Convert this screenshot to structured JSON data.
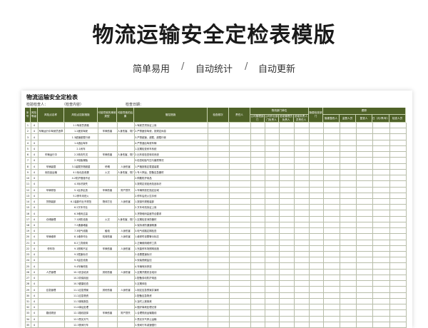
{
  "banner": {
    "title": "物流运输安全定检表模版",
    "features": [
      "简单易用",
      "自动统计",
      "自动更新"
    ],
    "separator": "/"
  },
  "sheet": {
    "title": "物流运输安全定检表",
    "meta": [
      "检验检查人：",
      "（检查内容）",
      "检查日期："
    ],
    "headers": {
      "seq": "序号",
      "risk_level": "风险等级",
      "risk_point": "风险点名称",
      "hazard": "风险点控制措施",
      "accident_type": "可能导致的事故类型",
      "consequence": "可能导致的后果",
      "control": "管控措施",
      "frequency": "检查频次",
      "responsible": "责任人",
      "group_main": "物流部门单位",
      "group_check": "跟踪",
      "sub": [
        "公司管理部门",
        "公司作业部门负责人",
        "班组管理员负责人",
        "班组负责人员责任人",
        "隐患检查部门",
        "隐患整改人",
        "监督人员",
        "复查人",
        "日（月/季/年）",
        "检查人员"
      ]
    },
    "rows": [
      {
        "seq": "1",
        "lvl": "4",
        "point": "",
        "item": "1.1驾驶员资格",
        "type": "",
        "result": "",
        "measure": "1.驾驶员须持证上岗"
      },
      {
        "seq": "2",
        "lvl": "4",
        "point": "车辆运行中驾驶员违章",
        "item": "1.2疲劳驾驶",
        "type": "车辆伤害",
        "result": "人身伤害、财产损失",
        "measure": "2.严禁疲劳驾驶，按规定休息"
      },
      {
        "seq": "3",
        "lvl": "4",
        "point": "",
        "item": "1.3超速超载行驶",
        "type": "",
        "result": "",
        "measure": "3.严禁超速、超载、超限行驶"
      },
      {
        "seq": "4",
        "lvl": "4",
        "point": "",
        "item": "1.4酒后驾车",
        "type": "",
        "result": "",
        "measure": "4.严禁酒后驾驶车辆"
      },
      {
        "seq": "5",
        "lvl": "4",
        "point": "",
        "item": "2.1刹车",
        "type": "",
        "result": "",
        "measure": "1.定期检查刹车系统"
      },
      {
        "seq": "6",
        "lvl": "4",
        "point": "车辆运行中",
        "item": "2.2转向失灵",
        "type": "车辆伤害",
        "result": "人身伤害、财产损失",
        "measure": "2.出车前检查转向系统"
      },
      {
        "seq": "7",
        "lvl": "4",
        "point": "",
        "item": "2.3轮胎爆胎",
        "type": "",
        "result": "",
        "measure": "3.检查轮胎气压与磨损情况"
      },
      {
        "seq": "8",
        "lvl": "4",
        "point": "车辆装载",
        "item": "3.1装载货物超重",
        "type": "坍塌",
        "result": "人身伤害",
        "measure": "1.严格按核定载重装载"
      },
      {
        "seq": "9",
        "lvl": "4",
        "point": "危险品运输",
        "item": "4.1危化品泄漏",
        "type": "火灾",
        "result": "人身伤害、财产损失",
        "measure": "1.专人押运，配备应急器材"
      },
      {
        "seq": "10",
        "lvl": "4",
        "point": "",
        "item": "4.2防护措施不足",
        "type": "",
        "result": "",
        "measure": "2.佩戴防护用品"
      },
      {
        "seq": "11",
        "lvl": "4",
        "point": "",
        "item": "4.3标识缺失",
        "type": "",
        "result": "",
        "measure": "3.按规定张贴危险品标识"
      },
      {
        "seq": "12",
        "lvl": "4",
        "point": "车辆停放",
        "item": "5.1乱停乱放",
        "type": "车辆伤害",
        "result": "财产损失",
        "measure": "1.车辆停放在指定区域"
      },
      {
        "seq": "13",
        "lvl": "4",
        "point": "",
        "item": "5.2停车未熄火",
        "type": "",
        "result": "",
        "measure": "2.停车后熄火拉手刹"
      },
      {
        "seq": "14",
        "lvl": "4",
        "point": "货物装卸",
        "item": "6.1装卸作业不规范",
        "type": "物体打击",
        "result": "人身伤害",
        "measure": "1.按操作规程装卸"
      },
      {
        "seq": "15",
        "lvl": "4",
        "point": "",
        "item": "6.2叉车作业",
        "type": "",
        "result": "",
        "measure": "2.叉车司机持证上岗"
      },
      {
        "seq": "16",
        "lvl": "4",
        "point": "",
        "item": "6.3堆码过高",
        "type": "",
        "result": "",
        "measure": "3.货物堆码高度符合要求"
      },
      {
        "seq": "17",
        "lvl": "4",
        "point": "仓储管理",
        "item": "7.1消防设施",
        "type": "火灾",
        "result": "人身伤害、财产损失",
        "measure": "1.定期检查消防器材"
      },
      {
        "seq": "18",
        "lvl": "4",
        "point": "",
        "item": "7.2通道堵塞",
        "type": "",
        "result": "",
        "measure": "2.保持消防通道畅通"
      },
      {
        "seq": "19",
        "lvl": "4",
        "point": "",
        "item": "7.3电气线路",
        "type": "触电",
        "result": "人身伤害",
        "measure": "3.电气线路定期检查"
      },
      {
        "seq": "20",
        "lvl": "4",
        "point": "车辆维修",
        "item": "8.1维修作业",
        "type": "机械伤害",
        "result": "人身伤害",
        "measure": "1.维修时设置警示标志"
      },
      {
        "seq": "21",
        "lvl": "4",
        "point": "",
        "item": "8.2工具使用",
        "type": "",
        "result": "",
        "measure": "2.正确使用维修工具"
      },
      {
        "seq": "22",
        "lvl": "4",
        "point": "停车场",
        "item": "9.1照明不足",
        "type": "车辆伤害",
        "result": "人身伤害",
        "measure": "1.完善停车场照明设施"
      },
      {
        "seq": "23",
        "lvl": "4",
        "point": "",
        "item": "9.2限速标识",
        "type": "",
        "result": "",
        "measure": "2.设置限速标识"
      },
      {
        "seq": "24",
        "lvl": "4",
        "point": "",
        "item": "9.3监控设施",
        "type": "",
        "result": "",
        "measure": "3.安装视频监控"
      },
      {
        "seq": "25",
        "lvl": "4",
        "point": "",
        "item": "9.4车辆停放",
        "type": "",
        "result": "",
        "measure": "4.车辆有序停放"
      },
      {
        "seq": "26",
        "lvl": "4",
        "point": "人员管理",
        "item": "10.1安全培训",
        "type": "其他伤害",
        "result": "人身伤害",
        "measure": "1.定期开展安全培训"
      },
      {
        "seq": "27",
        "lvl": "4",
        "point": "",
        "item": "10.2劳保用品",
        "type": "",
        "result": "",
        "measure": "2.配备劳动防护用品"
      },
      {
        "seq": "28",
        "lvl": "4",
        "point": "",
        "item": "10.3健康检查",
        "type": "",
        "result": "",
        "measure": "3.定期体检"
      },
      {
        "seq": "29",
        "lvl": "4",
        "point": "应急管理",
        "item": "11.1应急预案",
        "type": "其他伤害",
        "result": "人身伤害",
        "measure": "1.制定应急预案并演练"
      },
      {
        "seq": "30",
        "lvl": "4",
        "point": "",
        "item": "11.2应急物资",
        "type": "",
        "result": "",
        "measure": "2.配备应急物资"
      },
      {
        "seq": "31",
        "lvl": "4",
        "point": "",
        "item": "11.3事故报告",
        "type": "",
        "result": "",
        "measure": "3.及时上报事故"
      },
      {
        "seq": "32",
        "lvl": "4",
        "point": "",
        "item": "11.4事后处理",
        "type": "",
        "result": "",
        "measure": "4.做好事故处理记录"
      },
      {
        "seq": "33",
        "lvl": "4",
        "point": "路线规划",
        "item": "12.1路线选择",
        "type": "车辆伤害",
        "result": "财产损失",
        "measure": "1.合理规划运输路线"
      },
      {
        "seq": "34",
        "lvl": "4",
        "point": "",
        "item": "12.2恶劣天气",
        "type": "",
        "result": "",
        "measure": "2.恶劣天气停止运输"
      },
      {
        "seq": "35",
        "lvl": "4",
        "point": "",
        "item": "12.3夜间行车",
        "type": "",
        "result": "",
        "measure": "3.夜间行车减速慢行"
      }
    ]
  }
}
